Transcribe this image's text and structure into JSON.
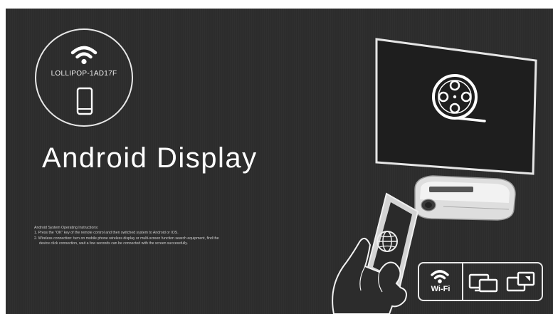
{
  "network": {
    "ssid": "LOLLIPOP-1AD17F"
  },
  "page": {
    "title": "Android Display"
  },
  "instructions": {
    "heading": "Android System Operating Instructions:",
    "step1": "1. Press the \"OK\" key of the remote control and then switched system to Android or IOS.",
    "step2_line1": "2. Wireless connection: turn on mobile phone wireless display or multi-screen function search equipment, find the",
    "step2_line2": "device click connection, wait a few seconds can be connected with the screen successfully."
  },
  "features": {
    "wifi_label": "Wi-Fi"
  },
  "icons": {
    "ssid_wifi": "wifi-icon",
    "ssid_device": "phone-icon",
    "screen": "film-reel-icon",
    "phone_screen": "globe-icon",
    "feature_wifi": "wifi-icon",
    "feature_mirror": "screen-mirror-icon",
    "feature_cast": "screen-cast-icon"
  },
  "colors": {
    "background": "#2c2c2c",
    "foreground": "#ffffff",
    "screen": "#1e1e1e"
  }
}
